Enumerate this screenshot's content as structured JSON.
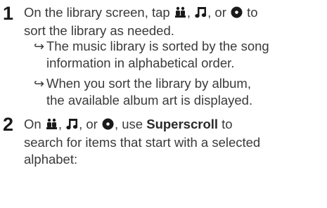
{
  "steps": [
    {
      "number": "1",
      "text_before_icons": "On the library screen, tap",
      "sep1": ",",
      "sep2": ", or",
      "text_after_icons": "to",
      "line2": "sort the library as needed.",
      "icons": [
        "person-icon",
        "music-note-icon",
        "disc-icon"
      ],
      "results": [
        {
          "arrow": "↪",
          "lines": [
            "The music library is sorted by the song",
            "information in alphabetical order."
          ]
        },
        {
          "arrow": "↪",
          "lines": [
            "When you sort the library by album,",
            "the available album art is displayed."
          ]
        }
      ]
    },
    {
      "number": "2",
      "text_before_icons": "On",
      "sep1": ",",
      "sep2": ", or",
      "text_after_icons": ", use",
      "bold_term": "Superscroll",
      "text_after_bold": "to",
      "line2": "search for items that start with a selected",
      "line3": "alphabet:",
      "icons": [
        "person-icon",
        "music-note-icon",
        "disc-icon"
      ]
    }
  ]
}
